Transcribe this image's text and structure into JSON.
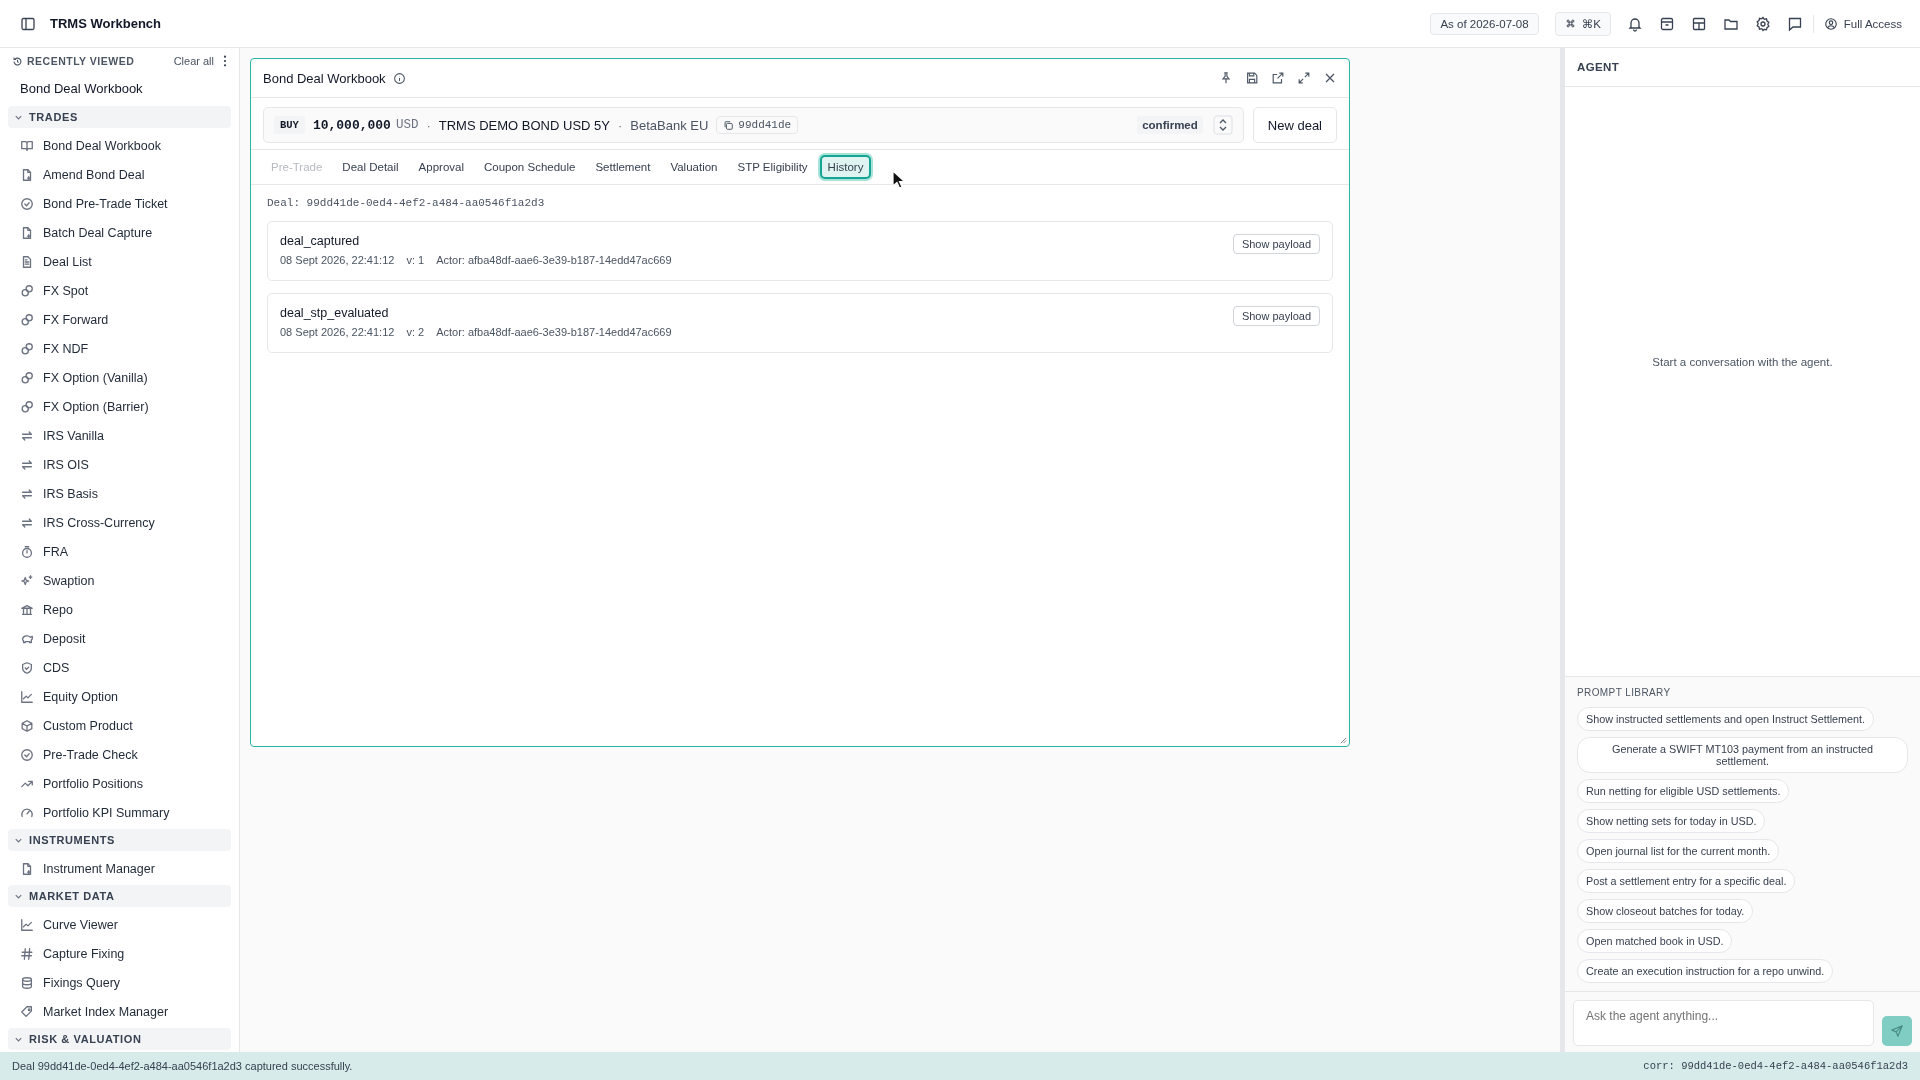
{
  "topbar": {
    "title": "TRMS Workbench",
    "as_of": "As of 2026-07-08",
    "shortcut": "⌘K",
    "access": "Full Access"
  },
  "sidebar": {
    "recent_title": "RECENTLY VIEWED",
    "clear": "Clear all",
    "recent_items": [
      "Bond Deal Workbook"
    ],
    "sections": [
      {
        "title": "TRADES",
        "expanded": true,
        "items": [
          "Bond Deal Workbook",
          "Amend Bond Deal",
          "Bond Pre-Trade Ticket",
          "Batch Deal Capture",
          "Deal List",
          "FX Spot",
          "FX Forward",
          "FX NDF",
          "FX Option (Vanilla)",
          "FX Option (Barrier)",
          "IRS Vanilla",
          "IRS OIS",
          "IRS Basis",
          "IRS Cross-Currency",
          "FRA",
          "Swaption",
          "Repo",
          "Deposit",
          "CDS",
          "Equity Option",
          "Custom Product",
          "Pre-Trade Check",
          "Portfolio Positions",
          "Portfolio KPI Summary"
        ]
      },
      {
        "title": "INSTRUMENTS",
        "expanded": true,
        "items": [
          "Instrument Manager"
        ]
      },
      {
        "title": "MARKET DATA",
        "expanded": true,
        "items": [
          "Curve Viewer",
          "Capture Fixing",
          "Fixings Query",
          "Market Index Manager"
        ]
      },
      {
        "title": "RISK & VALUATION",
        "expanded": true
      }
    ]
  },
  "workbook": {
    "title": "Bond Deal Workbook",
    "deal": {
      "separator": "·",
      "side": "BUY",
      "amount": "10,000,000",
      "currency": "USD",
      "instrument": "TRMS DEMO BOND USD 5Y",
      "counterparty": "BetaBank EU",
      "short_id": "99dd41de",
      "status": "confirmed"
    },
    "new_deal": "New deal",
    "tabs": [
      {
        "label": "Pre-Trade",
        "selected": false,
        "disabled": true
      },
      {
        "label": "Deal Detail",
        "selected": false,
        "disabled": false
      },
      {
        "label": "Approval",
        "selected": false,
        "disabled": false
      },
      {
        "label": "Coupon Schedule",
        "selected": false,
        "disabled": false
      },
      {
        "label": "Settlement",
        "selected": false,
        "disabled": false
      },
      {
        "label": "Valuation",
        "selected": false,
        "disabled": false
      },
      {
        "label": "STP Eligibility",
        "selected": false,
        "disabled": false
      },
      {
        "label": "History",
        "selected": true,
        "disabled": false
      }
    ],
    "deal_ref": "Deal: 99dd41de-0ed4-4ef2-a484-aa0546f1a2d3",
    "events": [
      {
        "name": "deal_captured",
        "timestamp": "08 Sept 2026, 22:41:12",
        "version": "v: 1",
        "actor": "Actor: afba48df-aae6-3e39-b187-14edd47ac669",
        "action": "Show payload"
      },
      {
        "name": "deal_stp_evaluated",
        "timestamp": "08 Sept 2026, 22:41:12",
        "version": "v: 2",
        "actor": "Actor: afba48df-aae6-3e39-b187-14edd47ac669",
        "action": "Show payload"
      }
    ]
  },
  "agent": {
    "title": "AGENT",
    "empty": "Start a conversation with the agent.",
    "library_title": "PROMPT LIBRARY",
    "prompts": [
      "Show instructed settlements and open Instruct Settlement.",
      "Generate a SWIFT MT103 payment from an instructed settlement.",
      "Run netting for eligible USD settlements.",
      "Show netting sets for today in USD.",
      "Open journal list for the current month.",
      "Post a settlement entry for a specific deal.",
      "Show closeout batches for today.",
      "Open matched book in USD.",
      "Create an execution instruction for a repo unwind."
    ],
    "input": {
      "placeholder": "Ask the agent anything..."
    }
  },
  "status_bar": {
    "message": "Deal 99dd41de-0ed4-4ef2-a484-aa0546f1a2d3 captured successfully.",
    "corr": "corr: 99dd41de-0ed4-4ef2-a484-aa0546f1a2d3"
  }
}
